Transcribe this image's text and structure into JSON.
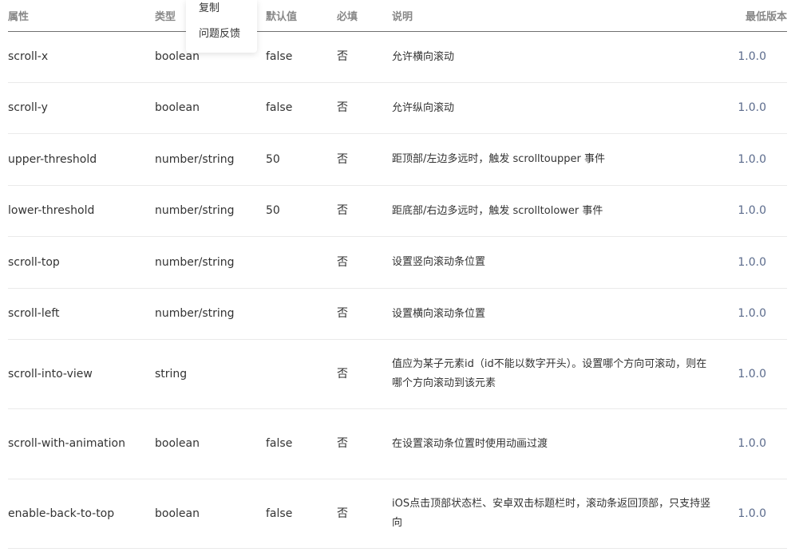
{
  "table": {
    "headers": {
      "name": "属性",
      "type": "类型",
      "default": "默认值",
      "required": "必填",
      "description": "说明",
      "version": "最低版本"
    },
    "rows": [
      {
        "name": "scroll-x",
        "type": "boolean",
        "default": "false",
        "required": "否",
        "description": "允许横向滚动",
        "version": "1.0.0"
      },
      {
        "name": "scroll-y",
        "type": "boolean",
        "default": "false",
        "required": "否",
        "description": "允许纵向滚动",
        "version": "1.0.0"
      },
      {
        "name": "upper-threshold",
        "type": "number/string",
        "default": "50",
        "required": "否",
        "description": "距顶部/左边多远时，触发 scrolltoupper 事件",
        "version": "1.0.0"
      },
      {
        "name": "lower-threshold",
        "type": "number/string",
        "default": "50",
        "required": "否",
        "description": "距底部/右边多远时，触发 scrolltolower 事件",
        "version": "1.0.0"
      },
      {
        "name": "scroll-top",
        "type": "number/string",
        "default": "",
        "required": "否",
        "description": "设置竖向滚动条位置",
        "version": "1.0.0"
      },
      {
        "name": "scroll-left",
        "type": "number/string",
        "default": "",
        "required": "否",
        "description": "设置横向滚动条位置",
        "version": "1.0.0"
      },
      {
        "name": "scroll-into-view",
        "type": "string",
        "default": "",
        "required": "否",
        "description": "值应为某子元素id（id不能以数字开头）。设置哪个方向可滚动，则在哪个方向滚动到该元素",
        "version": "1.0.0"
      },
      {
        "name": "scroll-with-animation",
        "type": "boolean",
        "default": "false",
        "required": "否",
        "description": "在设置滚动条位置时使用动画过渡",
        "version": "1.0.0"
      },
      {
        "name": "enable-back-to-top",
        "type": "boolean",
        "default": "false",
        "required": "否",
        "description": "iOS点击顶部状态栏、安卓双击标题栏时，滚动条返回顶部，只支持竖向",
        "version": "1.0.0"
      }
    ]
  },
  "context_menu": {
    "copy": "复制",
    "feedback": "问题反馈"
  }
}
